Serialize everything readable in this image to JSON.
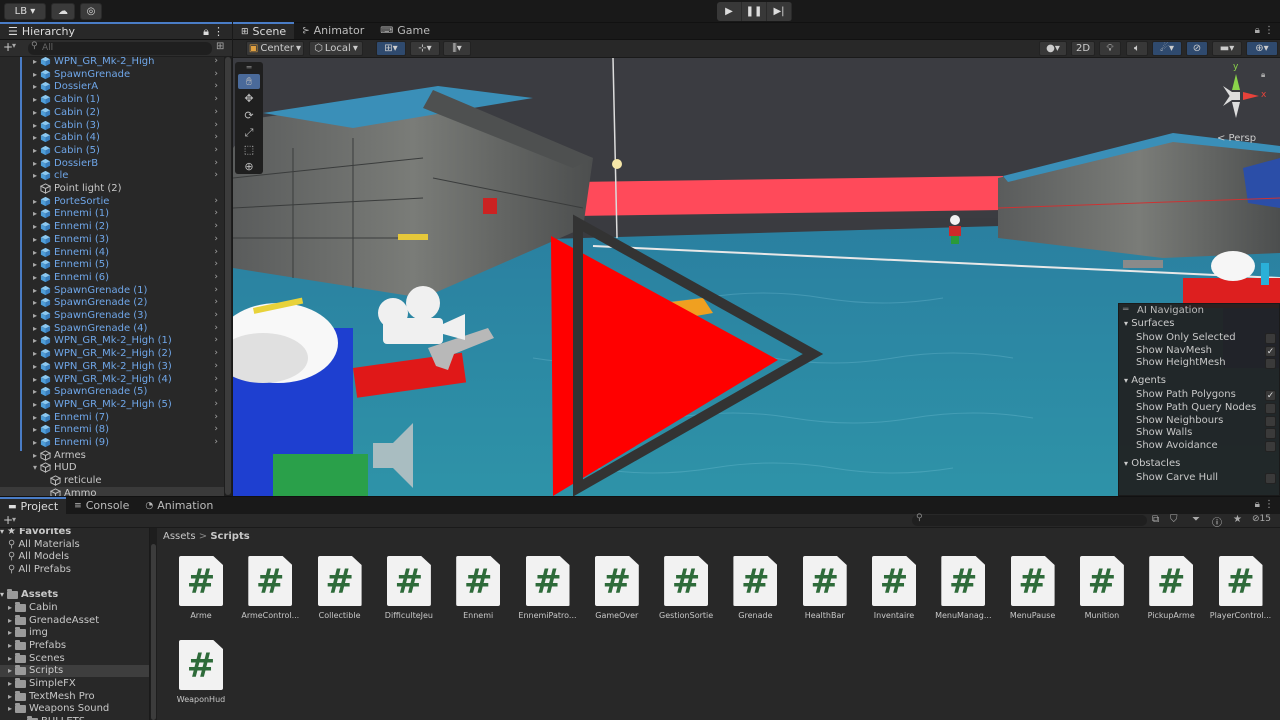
{
  "toolbar": {
    "account": "LB",
    "play_icons": [
      "play-icon",
      "pause-icon",
      "step-icon"
    ]
  },
  "hierarchy": {
    "tab_label": "Hierarchy",
    "add_label": "+",
    "search_placeholder": "All",
    "items": [
      {
        "label": "WPN_GR_Mk-2_High",
        "prefab": true
      },
      {
        "label": "SpawnGrenade",
        "prefab": true
      },
      {
        "label": "DossierA",
        "prefab": true
      },
      {
        "label": "Cabin (1)",
        "prefab": true
      },
      {
        "label": "Cabin (2)",
        "prefab": true
      },
      {
        "label": "Cabin (3)",
        "prefab": true
      },
      {
        "label": "Cabin (4)",
        "prefab": true
      },
      {
        "label": "Cabin (5)",
        "prefab": true
      },
      {
        "label": "DossierB",
        "prefab": true
      },
      {
        "label": "cle",
        "prefab": true
      },
      {
        "label": "Point light (2)",
        "prefab": false
      },
      {
        "label": "PorteSortie",
        "prefab": true
      },
      {
        "label": "Ennemi (1)",
        "prefab": true
      },
      {
        "label": "Ennemi (2)",
        "prefab": true
      },
      {
        "label": "Ennemi (3)",
        "prefab": true
      },
      {
        "label": "Ennemi (4)",
        "prefab": true
      },
      {
        "label": "Ennemi (5)",
        "prefab": true
      },
      {
        "label": "Ennemi (6)",
        "prefab": true
      },
      {
        "label": "SpawnGrenade (1)",
        "prefab": true
      },
      {
        "label": "SpawnGrenade (2)",
        "prefab": true
      },
      {
        "label": "SpawnGrenade (3)",
        "prefab": true
      },
      {
        "label": "SpawnGrenade (4)",
        "prefab": true
      },
      {
        "label": "WPN_GR_Mk-2_High (1)",
        "prefab": true
      },
      {
        "label": "WPN_GR_Mk-2_High (2)",
        "prefab": true
      },
      {
        "label": "WPN_GR_Mk-2_High (3)",
        "prefab": true
      },
      {
        "label": "WPN_GR_Mk-2_High (4)",
        "prefab": true
      },
      {
        "label": "SpawnGrenade (5)",
        "prefab": true
      },
      {
        "label": "WPN_GR_Mk-2_High (5)",
        "prefab": true
      },
      {
        "label": "Ennemi (7)",
        "prefab": true
      },
      {
        "label": "Ennemi (8)",
        "prefab": true
      },
      {
        "label": "Ennemi (9)",
        "prefab": true
      },
      {
        "label": "Armes",
        "prefab": false
      },
      {
        "label": "HUD",
        "prefab": false
      },
      {
        "label": "reticule",
        "prefab": false
      },
      {
        "label": "Ammo",
        "prefab": false
      }
    ]
  },
  "scene": {
    "tabs": [
      {
        "label": "Scene",
        "icon": "grid-icon",
        "active": true
      },
      {
        "label": "Animator",
        "icon": "animator-icon",
        "active": false
      },
      {
        "label": "Game",
        "icon": "gamepad-icon",
        "active": false
      }
    ],
    "pivot_label": "Center",
    "space_label": "Local",
    "mode_2d": "2D",
    "persp_label": "< Persp",
    "gizmo_axes": {
      "y": "y",
      "x": "x"
    },
    "colors": {
      "water": "#2f8aa5",
      "sky": "#3b3c41",
      "red": "#ff2020"
    }
  },
  "ai_navigation": {
    "title": "AI Navigation",
    "sections": [
      {
        "label": "Surfaces",
        "items": [
          {
            "label": "Show Only Selected",
            "checked": false
          },
          {
            "label": "Show NavMesh",
            "checked": true
          },
          {
            "label": "Show HeightMesh",
            "checked": false
          }
        ]
      },
      {
        "label": "Agents",
        "items": [
          {
            "label": "Show Path Polygons",
            "checked": true
          },
          {
            "label": "Show Path Query Nodes",
            "checked": false
          },
          {
            "label": "Show Neighbours",
            "checked": false
          },
          {
            "label": "Show Walls",
            "checked": false
          },
          {
            "label": "Show Avoidance",
            "checked": false
          }
        ]
      },
      {
        "label": "Obstacles",
        "items": [
          {
            "label": "Show Carve Hull",
            "checked": false
          }
        ]
      }
    ]
  },
  "project": {
    "tabs": [
      {
        "label": "Project",
        "icon": "folder-icon",
        "active": true
      },
      {
        "label": "Console",
        "icon": "console-icon",
        "active": false
      },
      {
        "label": "Animation",
        "icon": "animation-icon",
        "active": false
      }
    ],
    "hidden_count": "15",
    "breadcrumb": {
      "root": "Assets",
      "sep": ">",
      "current": "Scripts"
    },
    "tree": [
      {
        "label": "Favorites",
        "bold": true,
        "indent": 0,
        "star": true
      },
      {
        "label": "All Materials",
        "indent": 1,
        "search": true
      },
      {
        "label": "All Models",
        "indent": 1,
        "search": true
      },
      {
        "label": "All Prefabs",
        "indent": 1,
        "search": true
      },
      {
        "label": "Assets",
        "bold": true,
        "indent": 0
      },
      {
        "label": "Cabin",
        "indent": 1
      },
      {
        "label": "GrenadeAsset",
        "indent": 1
      },
      {
        "label": "img",
        "indent": 1
      },
      {
        "label": "Prefabs",
        "indent": 1
      },
      {
        "label": "Scenes",
        "indent": 1
      },
      {
        "label": "Scripts",
        "indent": 1,
        "selected": true
      },
      {
        "label": "SimpleFX",
        "indent": 1
      },
      {
        "label": "TextMesh Pro",
        "indent": 1
      },
      {
        "label": "Weapons Sound",
        "indent": 1
      },
      {
        "label": "BULLETS",
        "indent": 2
      }
    ],
    "scripts": [
      "Arme",
      "ArmeControl...",
      "Collectible",
      "DifficulteJeu",
      "Ennemi",
      "EnnemiPatro...",
      "GameOver",
      "GestionSortie",
      "Grenade",
      "HealthBar",
      "Inventaire",
      "MenuManag...",
      "MenuPause",
      "Munition",
      "PickupArme",
      "PlayerControl...",
      "WeaponHud"
    ],
    "script_glyph": "#"
  }
}
